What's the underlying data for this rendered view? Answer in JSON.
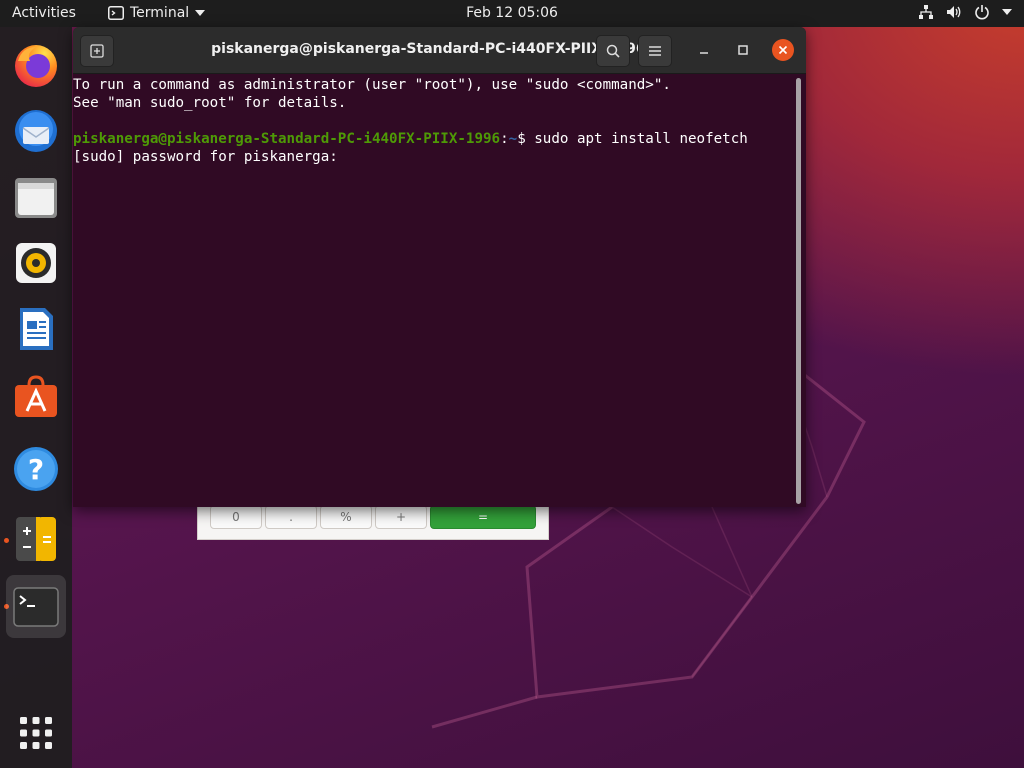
{
  "topbar": {
    "activities": "Activities",
    "app_name": "Terminal",
    "clock": "Feb 12  05:06",
    "tray_icons": [
      "network-icon",
      "volume-icon",
      "power-icon",
      "dropdown-icon"
    ]
  },
  "dock": {
    "items": [
      {
        "name": "firefox",
        "icon": "firefox-icon",
        "running": false
      },
      {
        "name": "thunderbird",
        "icon": "thunderbird-icon",
        "running": false
      },
      {
        "name": "files",
        "icon": "files-icon",
        "running": false
      },
      {
        "name": "rhythmbox",
        "icon": "rhythmbox-icon",
        "running": false
      },
      {
        "name": "writer",
        "icon": "writer-icon",
        "running": false
      },
      {
        "name": "software",
        "icon": "software-icon",
        "running": false
      },
      {
        "name": "help",
        "icon": "help-icon",
        "running": false
      },
      {
        "name": "calculator",
        "icon": "calculator-icon",
        "running": true
      },
      {
        "name": "terminal",
        "icon": "terminal-icon",
        "running": true,
        "active": true
      }
    ],
    "show_apps_icon": "grid-icon"
  },
  "calculator": {
    "keys": [
      "0",
      ".",
      "%",
      "+",
      "="
    ]
  },
  "terminal": {
    "title": "piskanerga@piskanerga-Standard-PC-i440FX-PIIX-1996: ~",
    "lines": {
      "l1": "To run a command as administrator (user \"root\"), use \"sudo <command>\".",
      "l2": "See \"man sudo_root\" for details.",
      "prompt_user": "piskanerga@piskanerga-Standard-PC-i440FX-PIIX-1996",
      "prompt_sep": ":",
      "prompt_path": "~",
      "prompt_cmd": "$ sudo apt install neofetch",
      "l4": "[sudo] password for piskanerga:"
    }
  },
  "colors": {
    "terminal_bg": "#300a24",
    "prompt_user": "#4e9a06",
    "accent": "#e95420"
  }
}
